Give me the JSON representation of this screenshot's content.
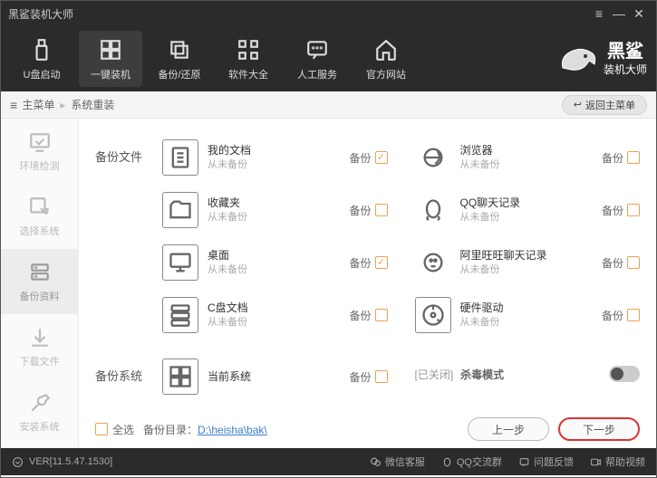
{
  "title": "黑鲨装机大师",
  "brand": {
    "big": "黑鲨",
    "small": "装机大师"
  },
  "topnav": [
    {
      "id": "usb",
      "label": "U盘启动"
    },
    {
      "id": "onekey",
      "label": "一键装机"
    },
    {
      "id": "backup",
      "label": "备份/还原"
    },
    {
      "id": "software",
      "label": "软件大全"
    },
    {
      "id": "service",
      "label": "人工服务"
    },
    {
      "id": "website",
      "label": "官方网站"
    }
  ],
  "crumb": {
    "menu": "主菜单",
    "current": "系统重装",
    "back": "返回主菜单"
  },
  "sidebar": [
    {
      "id": "env",
      "label": "环境检测"
    },
    {
      "id": "selsys",
      "label": "选择系统"
    },
    {
      "id": "bkres",
      "label": "备份资料"
    },
    {
      "id": "dl",
      "label": "下载文件"
    },
    {
      "id": "install",
      "label": "安装系统"
    }
  ],
  "sections": {
    "files": {
      "title": "备份文件",
      "items": [
        {
          "id": "docs",
          "name": "我的文档",
          "sub": "从未备份",
          "bk": "备份",
          "checked": true,
          "icon": "doc"
        },
        {
          "id": "browser",
          "name": "浏览器",
          "sub": "从未备份",
          "bk": "备份",
          "checked": false,
          "icon": "ie"
        },
        {
          "id": "fav",
          "name": "收藏夹",
          "sub": "从未备份",
          "bk": "备份",
          "checked": false,
          "icon": "folder"
        },
        {
          "id": "qq",
          "name": "QQ聊天记录",
          "sub": "从未备份",
          "bk": "备份",
          "checked": false,
          "icon": "qq"
        },
        {
          "id": "desktop",
          "name": "桌面",
          "sub": "从未备份",
          "bk": "备份",
          "checked": true,
          "icon": "monitor"
        },
        {
          "id": "ali",
          "name": "阿里旺旺聊天记录",
          "sub": "从未备份",
          "bk": "备份",
          "checked": false,
          "icon": "ali"
        },
        {
          "id": "cdrive",
          "name": "C盘文档",
          "sub": "从未备份",
          "bk": "备份",
          "checked": false,
          "icon": "server"
        },
        {
          "id": "hw",
          "name": "硬件驱动",
          "sub": "从未备份",
          "bk": "备份",
          "checked": false,
          "icon": "disk"
        }
      ]
    },
    "system": {
      "title": "备份系统",
      "item": {
        "id": "cursys",
        "name": "当前系统",
        "bk": "备份",
        "checked": false,
        "icon": "win"
      },
      "kill": {
        "prefix": "[已关闭]",
        "label": "杀毒模式"
      }
    }
  },
  "footer": {
    "selectall": "全选",
    "pathlabel": "备份目录：",
    "path": "D:\\heisha\\bak\\",
    "prev": "上一步",
    "next": "下一步"
  },
  "status": {
    "version": "VER[11.5.47.1530]",
    "links": [
      "微信客服",
      "QQ交流群",
      "问题反馈",
      "帮助视频"
    ]
  }
}
